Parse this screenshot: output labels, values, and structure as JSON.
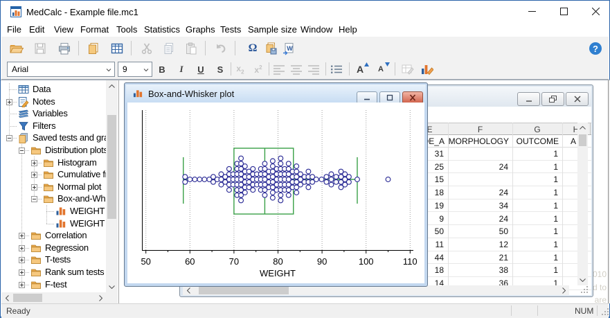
{
  "window": {
    "title": "MedCalc - Example file.mc1"
  },
  "menu": {
    "items": [
      "File",
      "Edit",
      "View",
      "Format",
      "Tools",
      "Statistics",
      "Graphs",
      "Tests",
      "Sample size",
      "Window",
      "Help"
    ]
  },
  "toolbar": {
    "items": [
      {
        "name": "open-file",
        "icon": "open",
        "disabled": false
      },
      {
        "name": "save-file",
        "icon": "save",
        "disabled": true
      },
      {
        "name": "print",
        "icon": "print",
        "disabled": false
      },
      {
        "name": "sep"
      },
      {
        "name": "duplicate",
        "icon": "copypage",
        "disabled": false
      },
      {
        "name": "new-table",
        "icon": "table",
        "disabled": false
      },
      {
        "name": "sep"
      },
      {
        "name": "cut",
        "icon": "cut",
        "disabled": true
      },
      {
        "name": "copy",
        "icon": "copy",
        "disabled": true
      },
      {
        "name": "paste",
        "icon": "paste",
        "disabled": true
      },
      {
        "name": "sep"
      },
      {
        "name": "undo",
        "icon": "undo",
        "disabled": true
      },
      {
        "name": "sep"
      },
      {
        "name": "insert-symbol",
        "icon": "omega",
        "disabled": false
      },
      {
        "name": "copy-save",
        "icon": "copysave",
        "disabled": false
      },
      {
        "name": "export-word",
        "icon": "word",
        "disabled": false
      }
    ],
    "help_label": "?"
  },
  "format_toolbar": {
    "font_name": "Arial",
    "font_size": "9",
    "bold": "B",
    "italic": "I",
    "underline": "U",
    "strike": "S",
    "subscript": "x",
    "subscript_n": "2",
    "superscript": "x",
    "superscript_n": "2",
    "grow_label": "A",
    "shrink_label": "A"
  },
  "sidebar": {
    "items": [
      {
        "label": "Data",
        "level": 0,
        "expander": null,
        "icon": "table"
      },
      {
        "label": "Notes",
        "level": 0,
        "expander": "plus",
        "icon": "notes"
      },
      {
        "label": "Variables",
        "level": 0,
        "expander": null,
        "icon": "layers"
      },
      {
        "label": "Filters",
        "level": 0,
        "expander": null,
        "icon": "filter"
      },
      {
        "label": "Saved tests and graphs",
        "level": 0,
        "expander": "minus",
        "icon": "sheets"
      },
      {
        "label": "Distribution plots",
        "level": 1,
        "expander": "minus",
        "icon": "folder"
      },
      {
        "label": "Histogram",
        "level": 2,
        "expander": "plus",
        "icon": "folder"
      },
      {
        "label": "Cumulative frequency",
        "level": 2,
        "expander": "plus",
        "icon": "folder"
      },
      {
        "label": "Normal plot",
        "level": 2,
        "expander": "plus",
        "icon": "folder"
      },
      {
        "label": "Box-and-Whisker",
        "level": 2,
        "expander": "minus",
        "icon": "folder"
      },
      {
        "label": "WEIGHT",
        "level": 3,
        "expander": null,
        "icon": "barchart"
      },
      {
        "label": "WEIGHT",
        "level": 3,
        "expander": null,
        "icon": "barchart"
      },
      {
        "label": "Correlation",
        "level": 1,
        "expander": "plus",
        "icon": "folder"
      },
      {
        "label": "Regression",
        "level": 1,
        "expander": "plus",
        "icon": "folder"
      },
      {
        "label": "T-tests",
        "level": 1,
        "expander": "plus",
        "icon": "folder"
      },
      {
        "label": "Rank sum tests",
        "level": 1,
        "expander": "plus",
        "icon": "folder"
      },
      {
        "label": "F-test",
        "level": 1,
        "expander": "plus",
        "icon": "folder"
      }
    ]
  },
  "plot_window": {
    "title": "Box-and-Whisker plot"
  },
  "chart_data": {
    "type": "box-dot",
    "xlabel": "WEIGHT",
    "xticks": [
      50,
      60,
      70,
      80,
      90,
      100,
      110
    ],
    "minor_ticks": [
      55,
      65,
      75,
      85,
      95,
      105
    ],
    "xlim": [
      49,
      111
    ],
    "box": {
      "low": 58.5,
      "q1": 70,
      "median": 77,
      "q3": 83.5,
      "high": 98
    },
    "outliers": [
      105
    ],
    "dot_columns": [
      [
        58.9,
        2
      ],
      [
        60,
        1
      ],
      [
        61.1,
        1
      ],
      [
        62.2,
        1
      ],
      [
        63.3,
        1
      ],
      [
        64.4,
        1
      ],
      [
        65.3,
        2
      ],
      [
        66.2,
        1
      ],
      [
        67.1,
        3
      ],
      [
        68,
        2
      ],
      [
        68.9,
        5
      ],
      [
        69.8,
        3
      ],
      [
        70.7,
        7
      ],
      [
        71.6,
        9
      ],
      [
        72.5,
        6
      ],
      [
        73.4,
        4
      ],
      [
        74.3,
        5
      ],
      [
        75.2,
        3
      ],
      [
        76.1,
        5
      ],
      [
        77,
        7
      ],
      [
        77.9,
        4
      ],
      [
        78.8,
        8
      ],
      [
        79.7,
        5
      ],
      [
        80.6,
        9
      ],
      [
        81.5,
        5
      ],
      [
        82.4,
        7
      ],
      [
        83.3,
        4
      ],
      [
        84.2,
        6
      ],
      [
        85.1,
        3
      ],
      [
        86,
        2
      ],
      [
        86.9,
        4
      ],
      [
        87.8,
        2
      ],
      [
        88.7,
        1
      ],
      [
        89.9,
        1
      ],
      [
        91,
        2
      ],
      [
        92.1,
        3
      ],
      [
        93.2,
        2
      ],
      [
        94.3,
        4
      ],
      [
        95.2,
        3
      ],
      [
        96.1,
        2
      ],
      [
        98,
        1
      ]
    ],
    "colors": {
      "box": "#38a046",
      "dot": "#2c2c96",
      "grid": "#9c9c9c",
      "axis": "#000000"
    }
  },
  "sheet_window": {
    "column_letters": [
      "E",
      "F",
      "G",
      "H"
    ],
    "column_names": [
      "DE_A",
      "MORPHOLOGY",
      "OUTCOME",
      "A"
    ],
    "rows": [
      [
        "31",
        "",
        "1"
      ],
      [
        "25",
        "24",
        "1"
      ],
      [
        "15",
        "",
        "1"
      ],
      [
        "18",
        "24",
        "1"
      ],
      [
        "19",
        "34",
        "1"
      ],
      [
        "9",
        "24",
        "1"
      ],
      [
        "50",
        "50",
        "1"
      ],
      [
        "11",
        "12",
        "1"
      ],
      [
        "44",
        "21",
        "1"
      ],
      [
        "18",
        "38",
        "1"
      ],
      [
        "14",
        "36",
        "1"
      ]
    ]
  },
  "watermark_lines": [
    "010",
    "d to",
    "are"
  ],
  "status": {
    "left": "Ready",
    "num": "NUM"
  }
}
